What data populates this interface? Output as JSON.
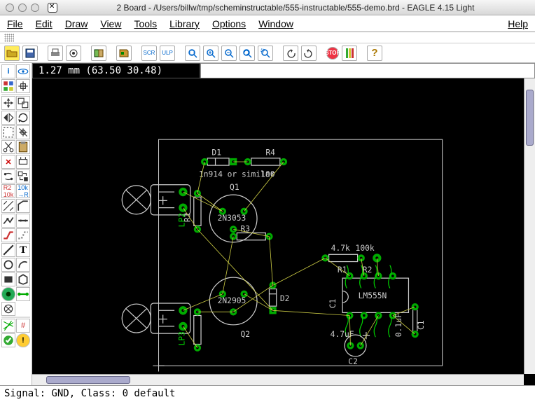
{
  "title": "2 Board - /Users/billw/tmp/scheminstructable/555-instructable/555-demo.brd - EAGLE 4.15 Light",
  "menu": {
    "file": "File",
    "edit": "Edit",
    "draw": "Draw",
    "view": "View",
    "tools": "Tools",
    "library": "Library",
    "options": "Options",
    "window": "Window",
    "help": "Help"
  },
  "coord": "1.27 mm (63.50 30.48)",
  "status": "Signal: GND, Class: 0 default",
  "labels": {
    "D1": "D1",
    "d1val": "1n914 or similar",
    "R4": "R4",
    "r4val": "100",
    "Q1": "Q1",
    "q1val": "2N3053",
    "R3": "R3",
    "R2": "R2",
    "LP2": "LP2",
    "LP3": "LP3",
    "Q2": "Q2",
    "q2val": "2N2905",
    "D2": "D2",
    "R1": "R1",
    "r1val": "4.7k",
    "R2b": "R2",
    "r2bval": "100k",
    "C1": "C1",
    "c1val": "0.1uF",
    "ic": "LM555N",
    "C2": "C2",
    "c2val": "4.7uF"
  }
}
